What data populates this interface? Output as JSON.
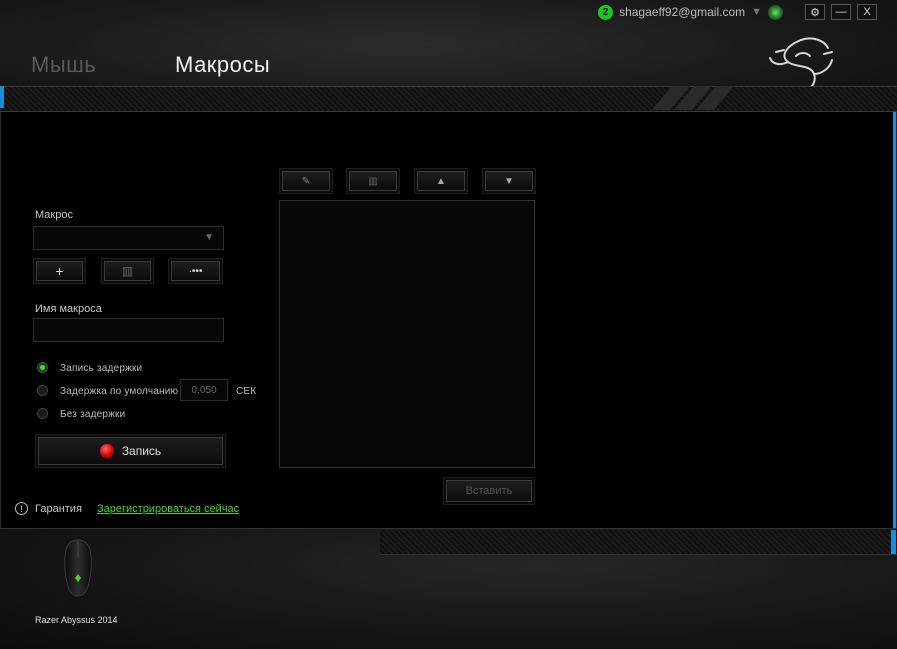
{
  "header": {
    "notification_count": "2",
    "email": "shagaeff92@gmail.com",
    "tabs": [
      {
        "label": "Мышь"
      },
      {
        "label": "Макросы"
      }
    ],
    "settings_glyph": "⚙",
    "minimize_glyph": "—",
    "close_glyph": "X"
  },
  "macro_panel": {
    "macro_label": "Макрос",
    "macro_select_value": "",
    "add_glyph": "+",
    "delete_glyph": "▥",
    "more_glyph": "·•••",
    "name_label": "Имя макроса",
    "name_value": "",
    "delay_options": [
      {
        "label": "Запись задержки",
        "selected": true
      },
      {
        "label": "Задержка по умолчанию",
        "selected": false
      },
      {
        "label": "Без задержки",
        "selected": false
      }
    ],
    "default_delay_value": "0.050",
    "delay_unit": "СЕК",
    "record_label": "Запись"
  },
  "editor": {
    "toolbar": [
      {
        "icon": "pencil-icon",
        "glyph": "✎"
      },
      {
        "icon": "trash-icon",
        "glyph": "▥"
      },
      {
        "icon": "arrow-up-icon",
        "glyph": "▲"
      },
      {
        "icon": "arrow-down-icon",
        "glyph": "▼"
      }
    ],
    "insert_label": "Вставить"
  },
  "warranty": {
    "label": "Гарантия",
    "link": "Зарегистрироваться сейчас"
  },
  "device": {
    "name": "Razer Abyssus 2014"
  },
  "colors": {
    "accent_green": "#44d62c",
    "record_red": "#d30000",
    "edge_blue": "#1b8fd6"
  }
}
